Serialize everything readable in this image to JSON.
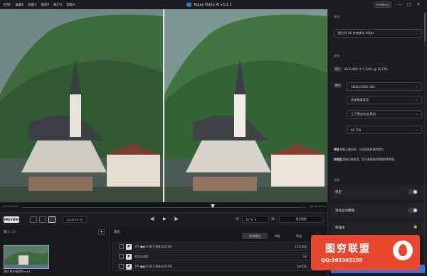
{
  "menu": {
    "file": "文件F",
    "edit": "编辑E",
    "view": "视图V",
    "process": "进程P",
    "account": "帐户A",
    "help": "帮助H"
  },
  "app_title": "Topaz Video AI  v3.2.3",
  "feedback_label": "Feedback",
  "window_controls": {
    "minimize": "—",
    "maximize": "□",
    "close": "✕"
  },
  "timeline": {
    "start": "00:00:00:00",
    "end": "00:00:33:23"
  },
  "controls": {
    "preview_label": "PREVIEW",
    "timecode": "00:05:23:23",
    "zoom": "32 %",
    "compare": "拆分视图"
  },
  "inputs": {
    "header": "输入 (1)",
    "add": "+",
    "file_name": "测试 哈尔施塔特.mp4"
  },
  "outputs": {
    "header": "输出",
    "tabs": [
      "所有输出",
      "待定",
      "导出"
    ],
    "rows": [
      {
        "label": "(P) ●◐(CHF) 3840x2160",
        "duration": "11m16s"
      },
      {
        "label": "852x480",
        "duration": "0s"
      },
      {
        "label": "(P) ●◐(CHF) 3840x2160",
        "duration": "1m23s"
      }
    ]
  },
  "sidebar": {
    "presets_label": "预设",
    "preset_value": "提升到 4K 并转换为 60fps",
    "output_label": "视频",
    "in_tag": "输入",
    "in_info": "852x480 (1:1 SAR) @ 30 FPS",
    "out_tag": "输出",
    "resolution": "3840x2160 (4K)",
    "crop": "添加像素类型",
    "scaling": "上下黑边/左右黑边",
    "fps": "60 FPS",
    "enhance_note_tag": "增强",
    "enhance_note": "超级已被启用，以实现高质量的提升。",
    "frame_note_tag": "帧插值",
    "frame_note": "超级已被启用，用于高质量的视频帧率转换。",
    "filters_label": "滤镜",
    "stabilize": "稳定",
    "motion_deblur": "消除运动模糊",
    "frame_interp": "帧插值",
    "export_label": "Export"
  },
  "watermark": {
    "title": "图穷联盟",
    "qq": "QQ:985303259"
  },
  "colors": {
    "accent": "#3a6fe0",
    "watermark": "#e8472f",
    "panel": "#1b1d21"
  }
}
